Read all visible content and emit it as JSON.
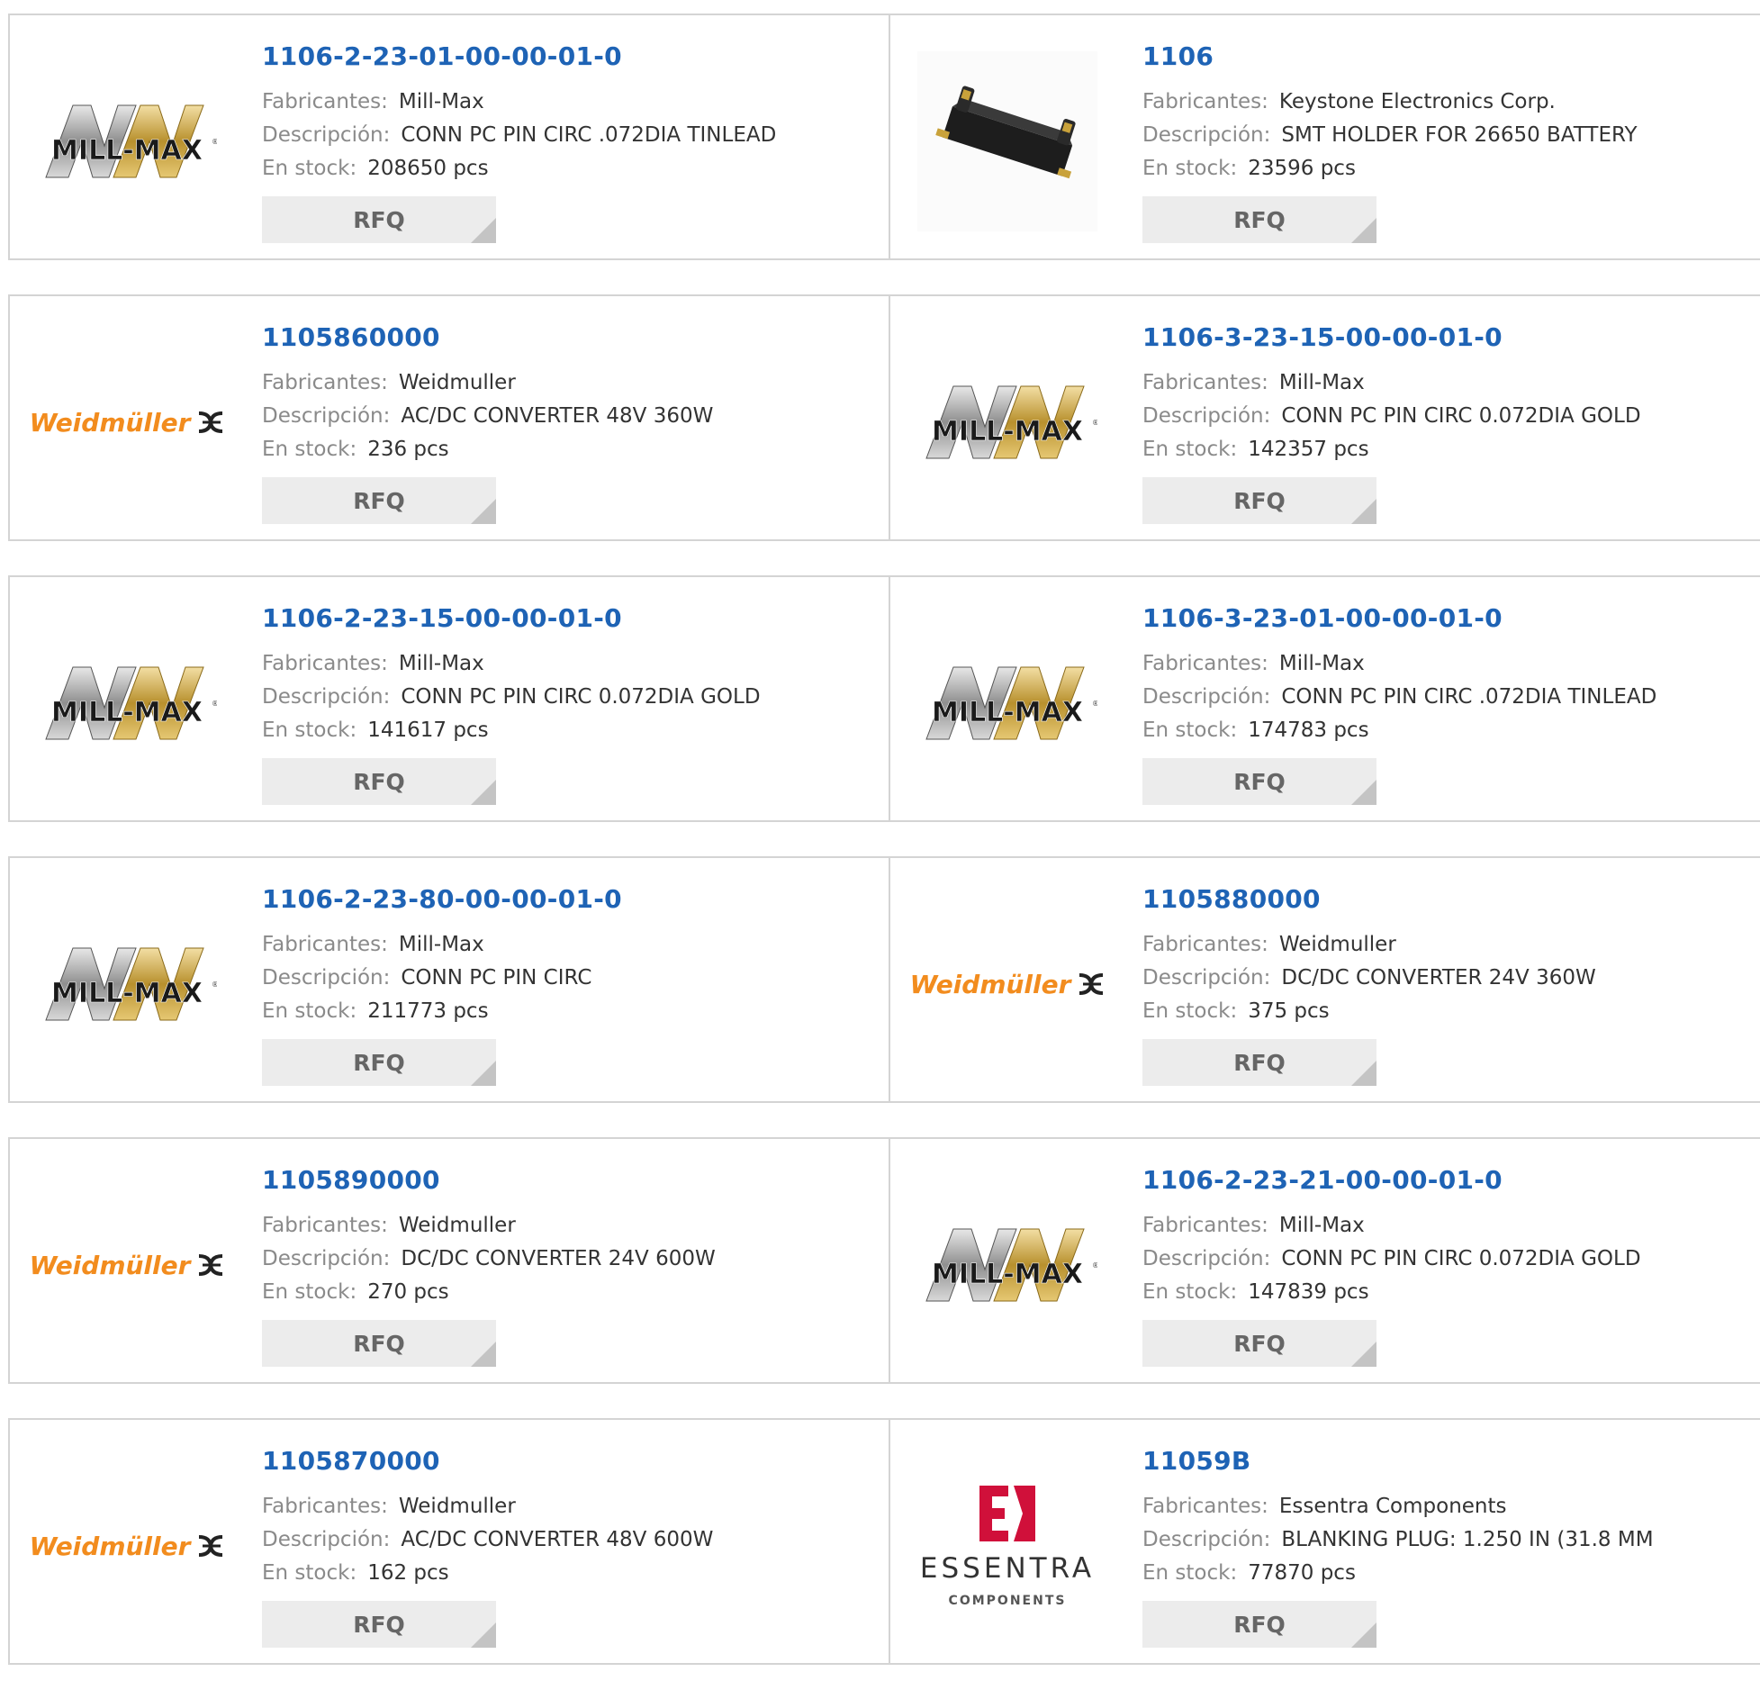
{
  "labels": {
    "manufacturer": "Fabricantes:",
    "description": "Descripción:",
    "stock": "En stock:",
    "rfq": "RFQ"
  },
  "logos": {
    "millmax_text": "MILL-MAX",
    "weidmuller_text": "Weidmüller",
    "essentra_text": "ESSENTRA",
    "essentra_sub": "COMPONENTS"
  },
  "products": [
    {
      "part": "1106-2-23-01-00-00-01-0",
      "manufacturer": "Mill-Max",
      "description": "CONN PC PIN CIRC .072DIA TINLEAD",
      "stock": "208650 pcs",
      "logo": "millmax"
    },
    {
      "part": "1106",
      "manufacturer": "Keystone Electronics Corp.",
      "description": "SMT HOLDER FOR 26650 BATTERY",
      "stock": "23596 pcs",
      "logo": "battery-holder"
    },
    {
      "part": "1105860000",
      "manufacturer": "Weidmuller",
      "description": "AC/DC CONVERTER 48V 360W",
      "stock": "236 pcs",
      "logo": "weidmuller"
    },
    {
      "part": "1106-3-23-15-00-00-01-0",
      "manufacturer": "Mill-Max",
      "description": "CONN PC PIN CIRC 0.072DIA GOLD",
      "stock": "142357 pcs",
      "logo": "millmax"
    },
    {
      "part": "1106-2-23-15-00-00-01-0",
      "manufacturer": "Mill-Max",
      "description": "CONN PC PIN CIRC 0.072DIA GOLD",
      "stock": "141617 pcs",
      "logo": "millmax"
    },
    {
      "part": "1106-3-23-01-00-00-01-0",
      "manufacturer": "Mill-Max",
      "description": "CONN PC PIN CIRC .072DIA TINLEAD",
      "stock": "174783 pcs",
      "logo": "millmax"
    },
    {
      "part": "1106-2-23-80-00-00-01-0",
      "manufacturer": "Mill-Max",
      "description": "CONN PC PIN CIRC",
      "stock": "211773 pcs",
      "logo": "millmax"
    },
    {
      "part": "1105880000",
      "manufacturer": "Weidmuller",
      "description": "DC/DC CONVERTER 24V 360W",
      "stock": "375 pcs",
      "logo": "weidmuller"
    },
    {
      "part": "1105890000",
      "manufacturer": "Weidmuller",
      "description": "DC/DC CONVERTER 24V 600W",
      "stock": "270 pcs",
      "logo": "weidmuller"
    },
    {
      "part": "1106-2-23-21-00-00-01-0",
      "manufacturer": "Mill-Max",
      "description": "CONN PC PIN CIRC 0.072DIA GOLD",
      "stock": "147839 pcs",
      "logo": "millmax"
    },
    {
      "part": "1105870000",
      "manufacturer": "Weidmuller",
      "description": "AC/DC CONVERTER 48V 600W",
      "stock": "162 pcs",
      "logo": "weidmuller"
    },
    {
      "part": "11059B",
      "manufacturer": "Essentra Components",
      "description": "BLANKING PLUG: 1.250 IN (31.8 MM",
      "stock": "77870 pcs",
      "logo": "essentra"
    }
  ]
}
